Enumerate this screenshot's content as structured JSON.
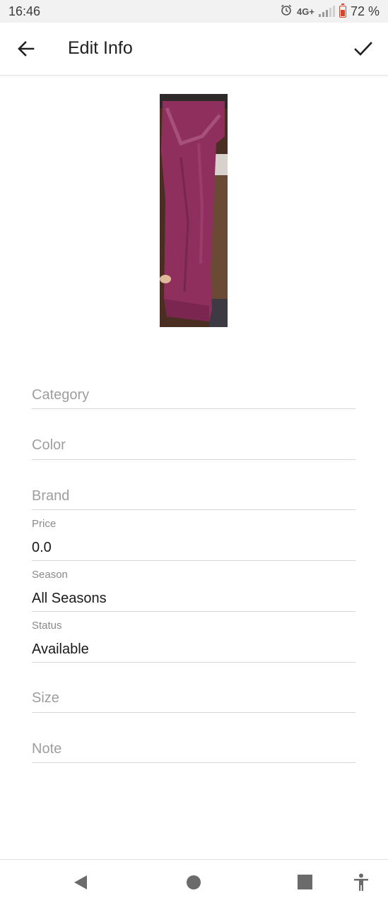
{
  "status_bar": {
    "time": "16:46",
    "network": "4G+",
    "battery": "72 %",
    "icons": [
      "alarm-icon",
      "signal-icon",
      "battery-icon"
    ]
  },
  "app_bar": {
    "title": "Edit Info",
    "back_icon": "arrow-left-icon",
    "save_icon": "check-icon"
  },
  "photo": {
    "subject": "burgundy trousers"
  },
  "fields": {
    "category": {
      "placeholder": "Category"
    },
    "color": {
      "placeholder": "Color"
    },
    "brand": {
      "placeholder": "Brand"
    },
    "price": {
      "label": "Price",
      "value": "0.0"
    },
    "season": {
      "label": "Season",
      "value": "All Seasons"
    },
    "status": {
      "label": "Status",
      "value": "Available"
    },
    "size": {
      "placeholder": "Size"
    },
    "note": {
      "placeholder": "Note"
    }
  },
  "nav_bar": {
    "icons": [
      "back-triangle-icon",
      "home-circle-icon",
      "recents-square-icon",
      "accessibility-icon"
    ]
  },
  "colors": {
    "status_bar_bg": "#f2f2f2",
    "battery_red": "#d9452b",
    "divider": "#d6d6d6",
    "placeholder_text": "#9e9e9e",
    "trousers": "#8e2f5e"
  }
}
